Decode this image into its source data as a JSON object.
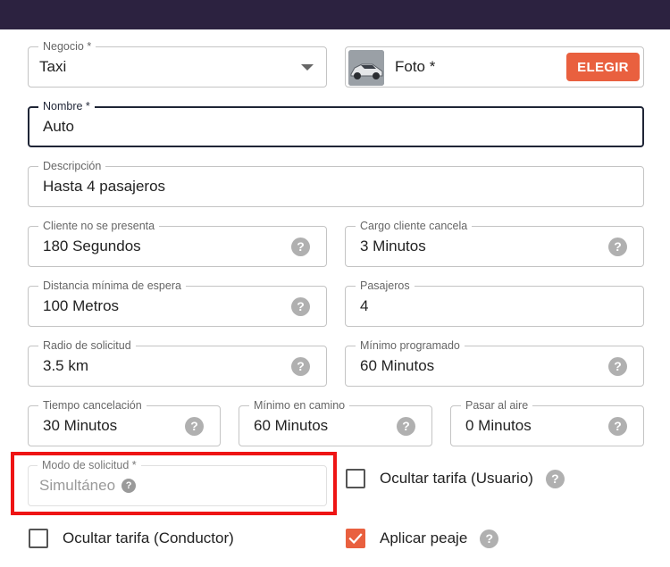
{
  "form": {
    "negocio": {
      "label": "Negocio *",
      "value": "Taxi"
    },
    "foto": {
      "label": "Foto *",
      "button": "ELEGIR"
    },
    "nombre": {
      "label": "Nombre *",
      "value": "Auto"
    },
    "descripcion": {
      "label": "Descripción",
      "value": "Hasta 4 pasajeros"
    },
    "cliente_no_presenta": {
      "label": "Cliente no se presenta",
      "value": "180 Segundos"
    },
    "cargo_cliente_cancela": {
      "label": "Cargo cliente cancela",
      "value": "3 Minutos"
    },
    "distancia_minima_espera": {
      "label": "Distancia mínima de espera",
      "value": "100 Metros"
    },
    "pasajeros": {
      "label": "Pasajeros",
      "value": "4"
    },
    "radio_solicitud": {
      "label": "Radio de solicitud",
      "value": "3.5 km"
    },
    "minimo_programado": {
      "label": "Mínimo programado",
      "value": "60 Minutos"
    },
    "tiempo_cancelacion": {
      "label": "Tiempo cancelación",
      "value": "30 Minutos"
    },
    "minimo_en_camino": {
      "label": "Mínimo en camino",
      "value": "60 Minutos"
    },
    "pasar_al_aire": {
      "label": "Pasar al aire",
      "value": "0 Minutos"
    },
    "modo_solicitud": {
      "label": "Modo de solicitud *",
      "value": "Simultáneo"
    },
    "ocultar_tarifa_usuario": {
      "label": "Ocultar tarifa (Usuario)",
      "checked": false
    },
    "ocultar_tarifa_conductor": {
      "label": "Ocultar tarifa (Conductor)",
      "checked": false
    },
    "aplicar_peaje": {
      "label": "Aplicar peaje",
      "checked": true
    }
  },
  "help_glyph": "?",
  "colors": {
    "accent": "#e9603f",
    "topbar": "#2c2240",
    "highlight": "#ee1414",
    "focus_border": "#1f2536"
  },
  "icons": {
    "select": "chevron-down-icon",
    "help": "help-circle-icon",
    "checkbox_checked": "checkmark-icon"
  }
}
